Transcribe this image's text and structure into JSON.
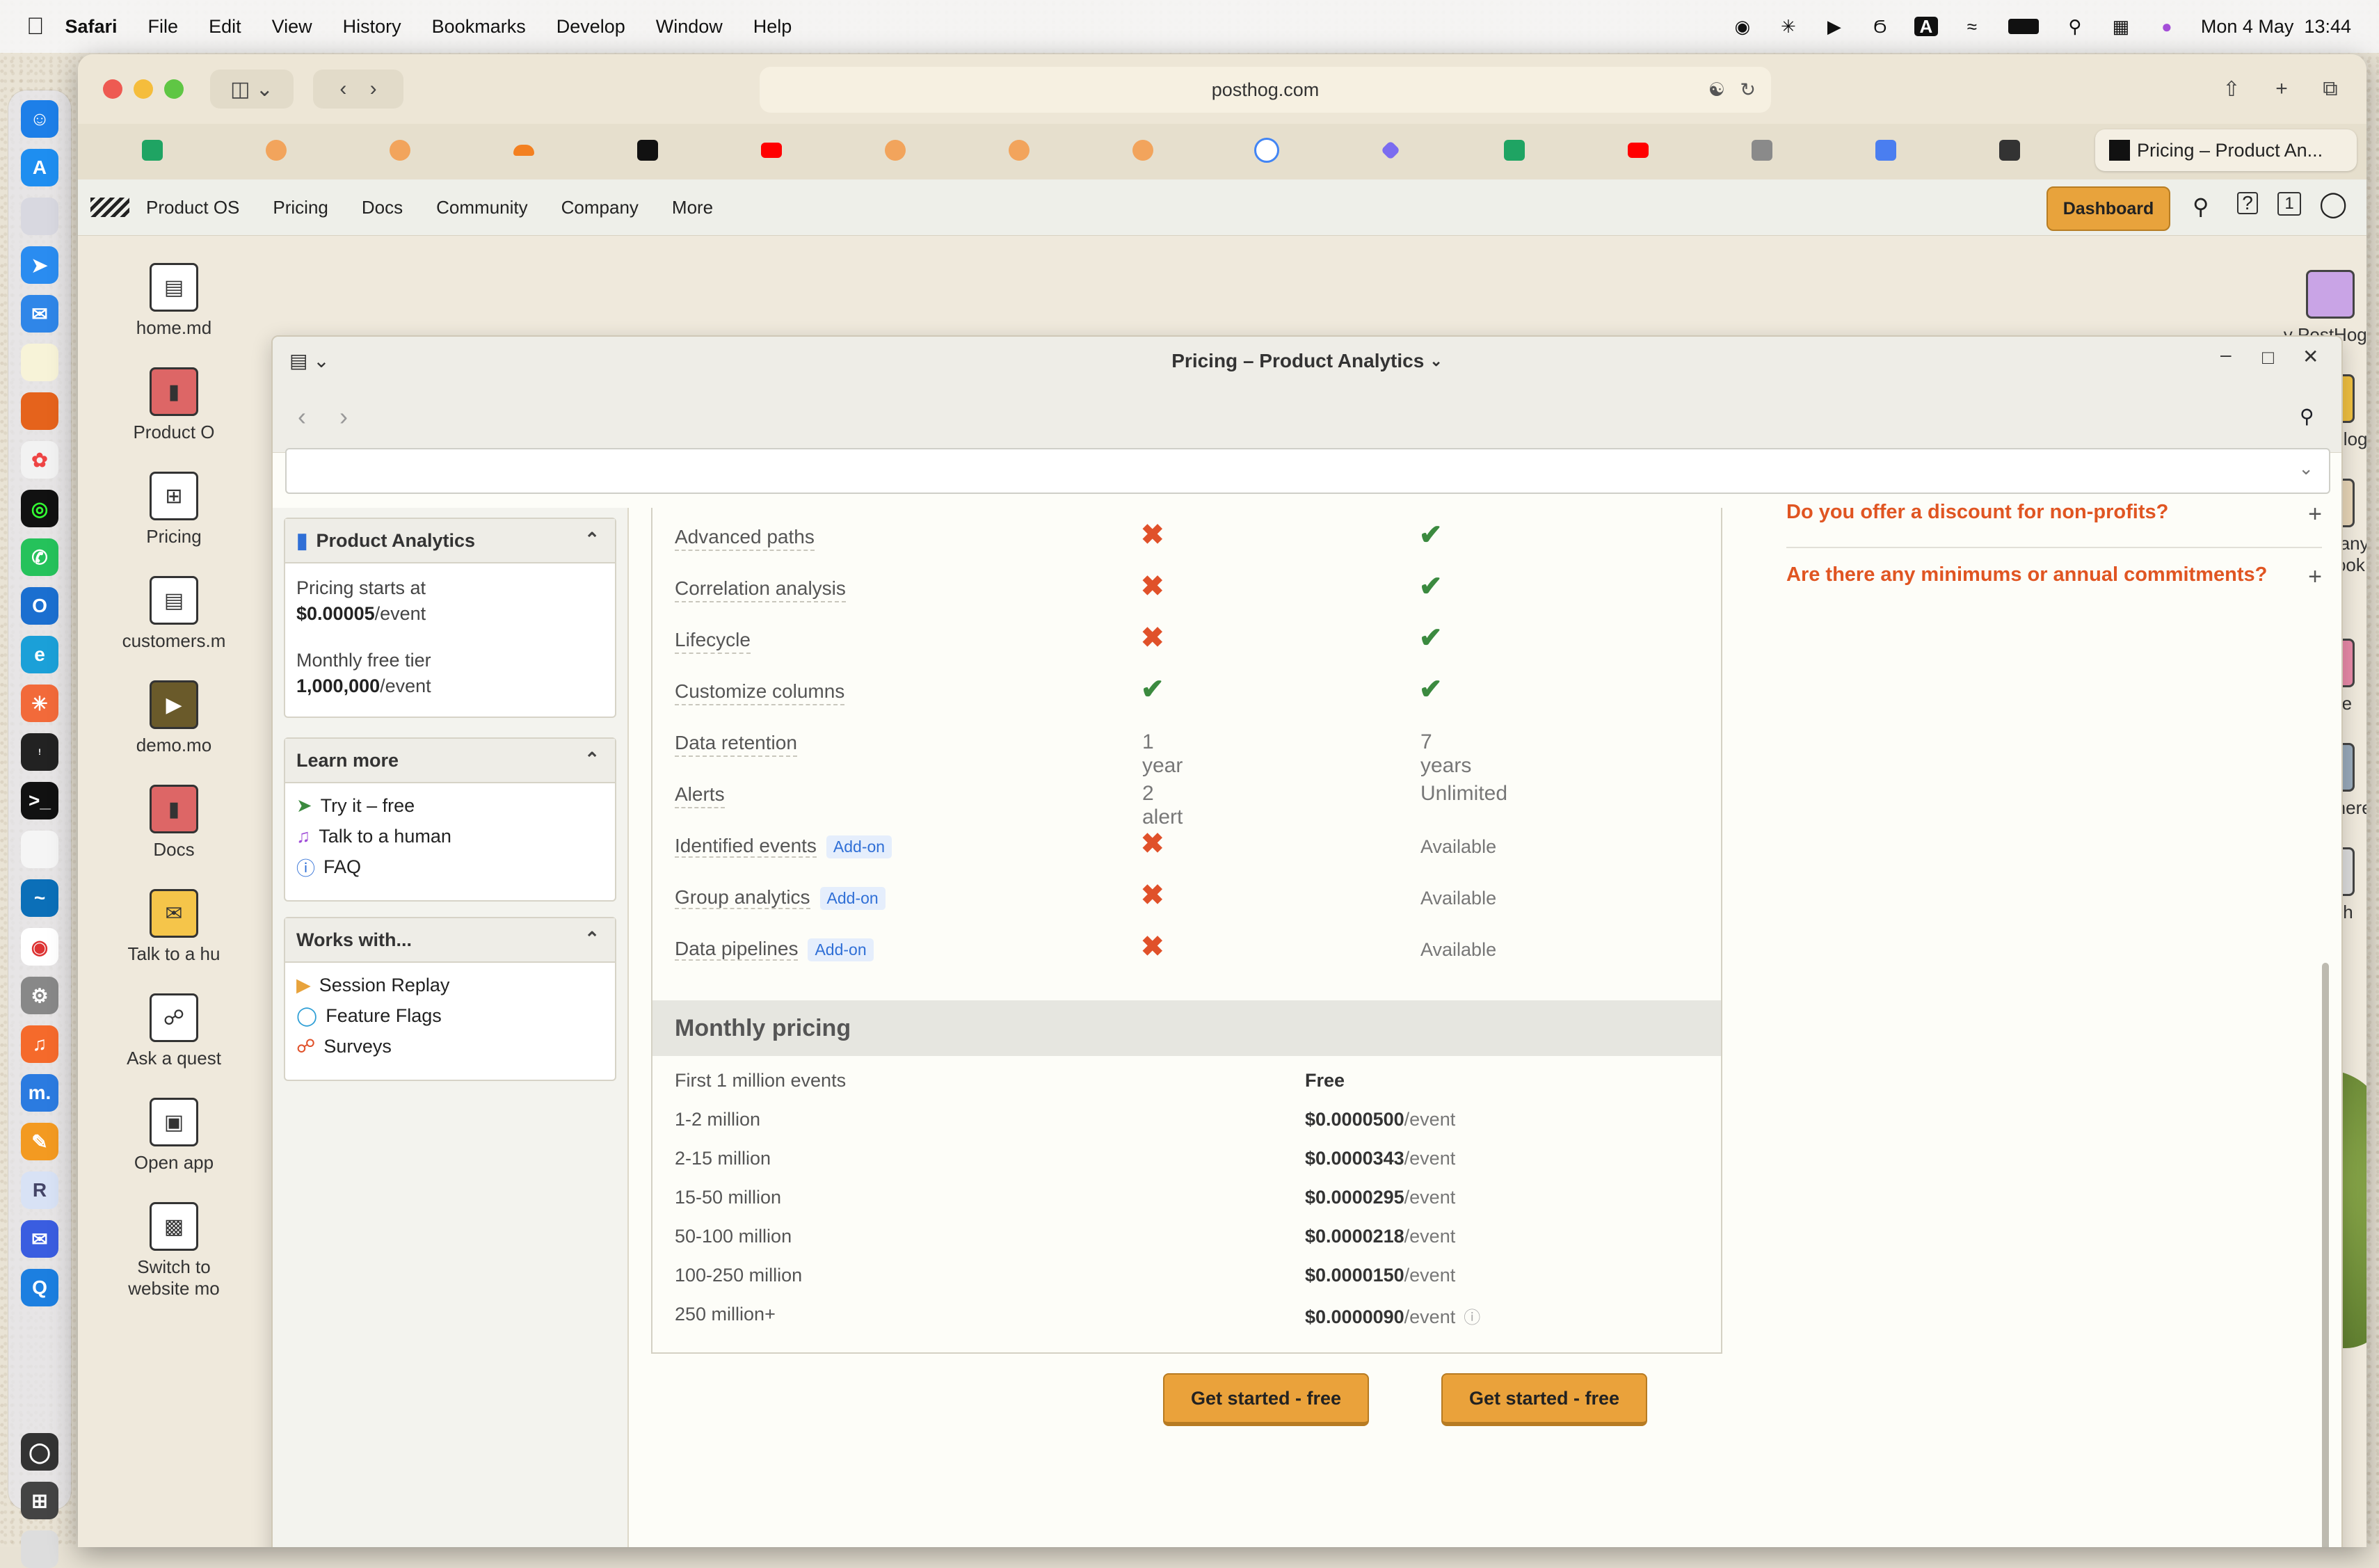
{
  "menubar": {
    "app": "Safari",
    "items": [
      "File",
      "Edit",
      "View",
      "History",
      "Bookmarks",
      "Develop",
      "Window",
      "Help"
    ],
    "clock": "Mon 4 May  13:44"
  },
  "browser": {
    "url": "posthog.com",
    "active_tab": "Pricing – Product An..."
  },
  "site_nav": {
    "items": [
      "Product OS",
      "Pricing",
      "Docs",
      "Community",
      "Company",
      "More"
    ],
    "dashboard": "Dashboard",
    "notif_count": "1"
  },
  "desktop_left": [
    "home.md",
    "Product O",
    "Pricing",
    "customers.m",
    "demo.mo",
    "Docs",
    "Talk to a hu",
    "Ask a quest",
    "Open app",
    "Switch to\nwebsite mo"
  ],
  "desktop_right": [
    "y PostHog?",
    "hangelog",
    "Company\nandbook",
    "Store",
    "Work here",
    "Trash"
  ],
  "window": {
    "title": "Pricing – Product Analytics"
  },
  "sidebar": {
    "product_panel": {
      "title": "Product Analytics",
      "pricing_label": "Pricing starts at",
      "pricing_value": "$0.00005",
      "pricing_unit": "/event",
      "free_label": "Monthly free tier",
      "free_value": "1,000,000",
      "free_unit": "/event"
    },
    "learn_panel": {
      "title": "Learn more",
      "links": [
        "Try it – free",
        "Talk to a human",
        "FAQ"
      ]
    },
    "works_panel": {
      "title": "Works with...",
      "links": [
        "Session Replay",
        "Feature Flags",
        "Surveys"
      ]
    }
  },
  "features": [
    {
      "label": "Advanced paths",
      "addon": "",
      "free": "x",
      "paid": "check"
    },
    {
      "label": "Correlation analysis",
      "addon": "",
      "free": "x",
      "paid": "check"
    },
    {
      "label": "Lifecycle",
      "addon": "",
      "free": "x",
      "paid": "check"
    },
    {
      "label": "Customize columns",
      "addon": "",
      "free": "check",
      "paid": "check"
    },
    {
      "label": "Data retention",
      "addon": "",
      "free": "1 year",
      "paid": "7 years"
    },
    {
      "label": "Alerts",
      "addon": "",
      "free": "2 alert",
      "paid": "Unlimited"
    },
    {
      "label": "Identified events",
      "addon": "Add-on",
      "free": "x",
      "paid": "Available"
    },
    {
      "label": "Group analytics",
      "addon": "Add-on",
      "free": "x",
      "paid": "Available"
    },
    {
      "label": "Data pipelines",
      "addon": "Add-on",
      "free": "x",
      "paid": "Available"
    }
  ],
  "monthly_pricing": {
    "title": "Monthly pricing",
    "rows": [
      {
        "tier": "First 1 million events",
        "price": "Free",
        "unit": ""
      },
      {
        "tier": "1-2 million",
        "price": "$0.0000500",
        "unit": "/event"
      },
      {
        "tier": "2-15 million",
        "price": "$0.0000343",
        "unit": "/event"
      },
      {
        "tier": "15-50 million",
        "price": "$0.0000295",
        "unit": "/event"
      },
      {
        "tier": "50-100 million",
        "price": "$0.0000218",
        "unit": "/event"
      },
      {
        "tier": "100-250 million",
        "price": "$0.0000150",
        "unit": "/event"
      },
      {
        "tier": "250 million+",
        "price": "$0.0000090",
        "unit": "/event"
      }
    ]
  },
  "cta": {
    "free_button": "Get started - free",
    "paid_button": "Get started - free"
  },
  "faq": [
    "Do you offer a discount for non-profits?",
    "Are there any minimums or annual commitments?"
  ],
  "colors": {
    "accent": "#eaa23b",
    "x_mark": "#e0512a",
    "check": "#3b8a3f",
    "faq_link": "#e05522",
    "addon_bg": "#e5eefc",
    "addon_text": "#2f6fd6"
  }
}
